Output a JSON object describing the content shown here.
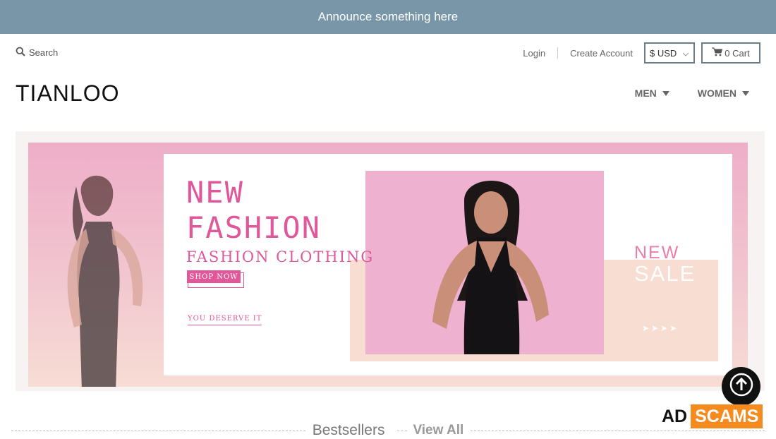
{
  "announcement": {
    "text": "Announce something here"
  },
  "header": {
    "search_label": "Search",
    "login_label": "Login",
    "create_account_label": "Create Account",
    "currency_value": "$ USD",
    "cart_label": "0 Cart",
    "logo_text": "TIANLOO"
  },
  "nav": {
    "items": [
      {
        "label": "MEN"
      },
      {
        "label": "WOMEN"
      }
    ]
  },
  "banner": {
    "title_line1": "NEW",
    "title_line2": "FASHION",
    "subtitle": "FASHION CLOTHING",
    "shop_now": "SHOP NOW",
    "tagline": "YOU DESERVE IT",
    "side_new": "NEW",
    "side_sale": "SALE",
    "side_arrows": "➤➤➤➤"
  },
  "section": {
    "title": "Bestsellers",
    "view_all": "View All"
  },
  "badge": {
    "ad": "AD",
    "scams": "SCAMS"
  },
  "colors": {
    "announcement_bg": "#7896a8",
    "accent_pink": "#e0579a",
    "badge_orange": "#f58a1f"
  }
}
